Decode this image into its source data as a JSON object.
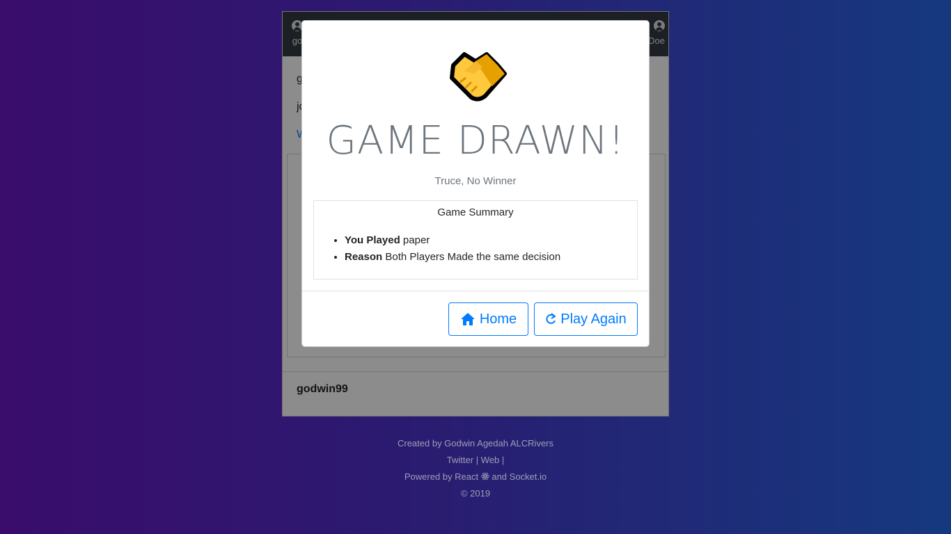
{
  "game": {
    "player_left": "go",
    "player_right": "Doe",
    "lines": [
      "g",
      "jo",
      "W"
    ],
    "footer_user": "godwin99"
  },
  "modal": {
    "title": "GAME DRAWN!",
    "subtitle": "Truce, No Winner",
    "summary_title": "Game Summary",
    "summary_items": [
      {
        "label": "You Played",
        "value": "paper"
      },
      {
        "label": "Reason",
        "value": "Both Players Made the same decision"
      }
    ],
    "buttons": {
      "home": "Home",
      "play_again": "Play Again"
    },
    "icon": "handshake-icon"
  },
  "footer": {
    "created_by": "Created by Godwin Agedah ALCRivers",
    "links": [
      "Twitter",
      "Web"
    ],
    "powered_prefix": "Powered by React",
    "powered_suffix": "and Socket.io",
    "copyright": "© 2019"
  },
  "colors": {
    "accent": "#007bff",
    "header_bg": "#343a40",
    "handshake_yellow": "#ffc83d"
  }
}
